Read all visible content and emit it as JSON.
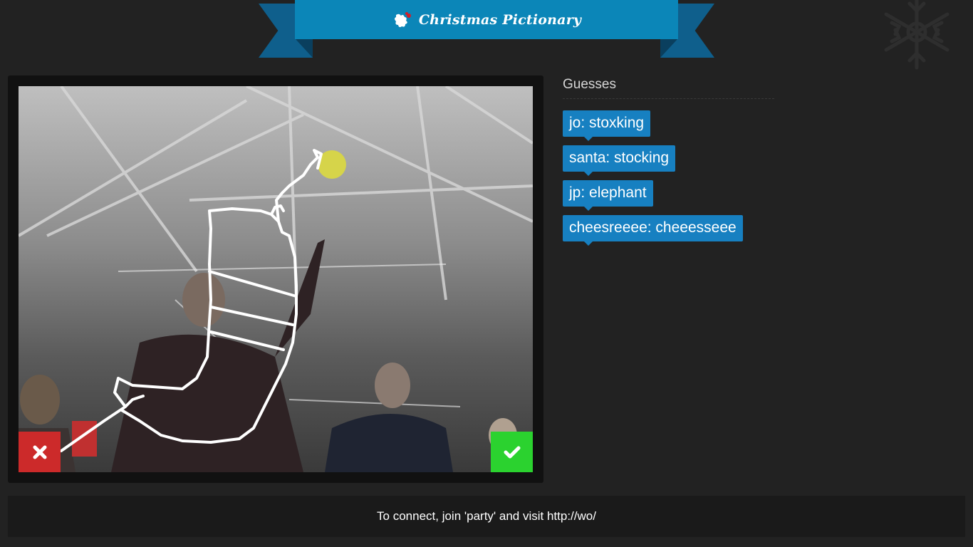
{
  "header": {
    "title": "Christmas Pictionary",
    "logo_icon": "holly-icon",
    "decoration_icon": "snowflake-icon",
    "accent_color": "#0b86b8"
  },
  "board": {
    "reject_icon": "close-icon",
    "accept_icon": "check-icon",
    "reject_color": "#cc2a2a",
    "accept_color": "#2bd22f"
  },
  "guesses": {
    "heading": "Guesses",
    "items": [
      "jo: stoxking",
      "santa: stocking",
      "jp: elephant",
      "cheesreeee: cheeesseee"
    ]
  },
  "footer": {
    "text": "To connect, join 'party' and visit http://wo/"
  }
}
